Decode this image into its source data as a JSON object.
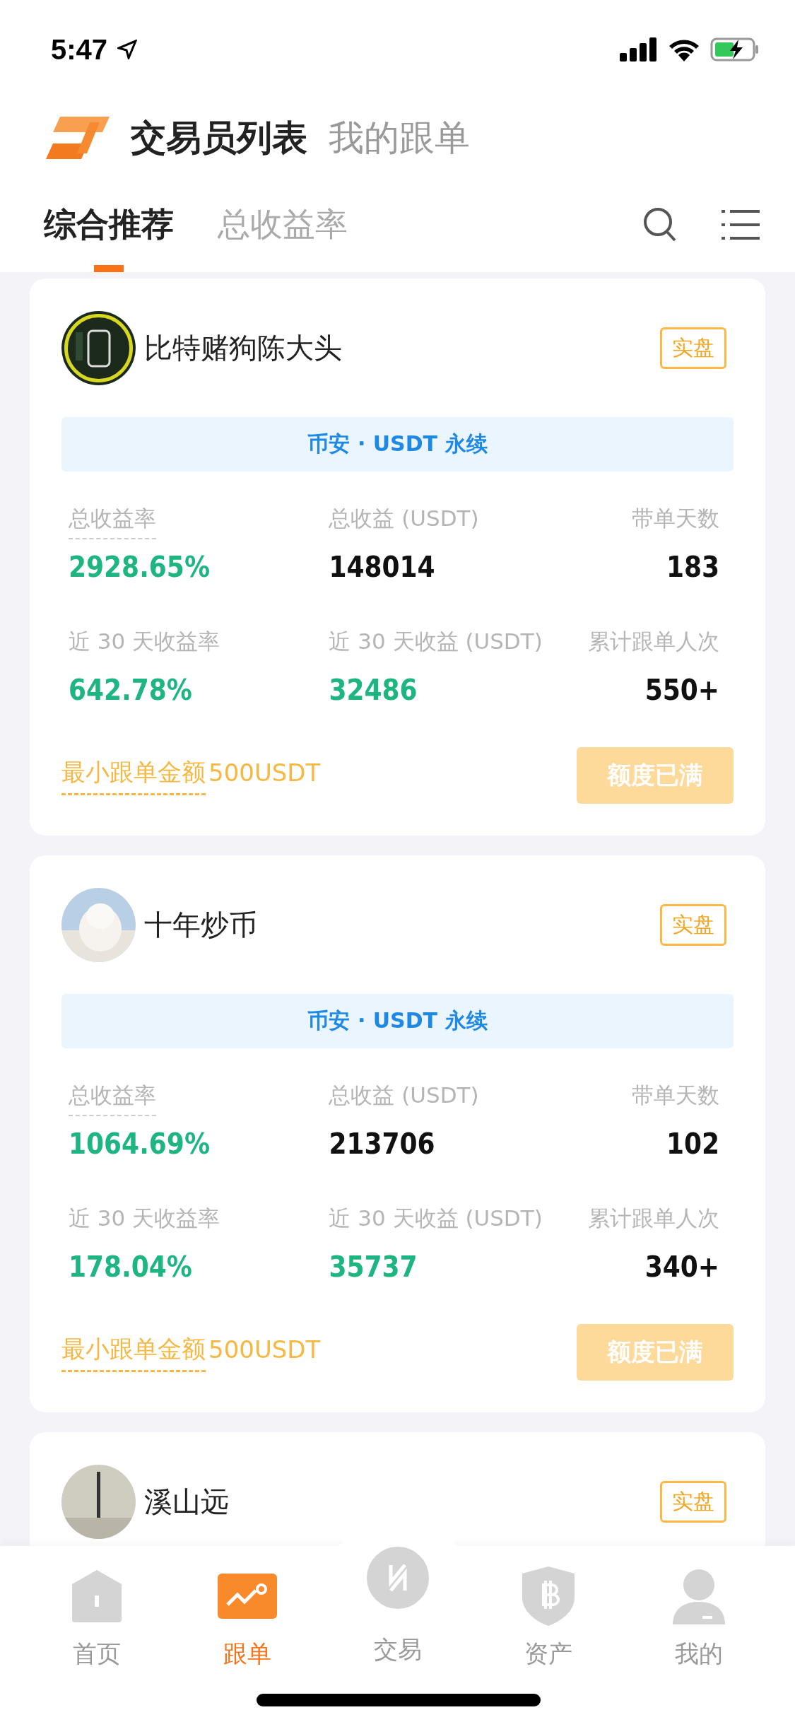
{
  "status_bar": {
    "time": "5:47"
  },
  "header": {
    "title": "交易员列表",
    "secondary": "我的跟单"
  },
  "tabs": [
    {
      "label": "综合推荐",
      "selected": true
    },
    {
      "label": "总收益率",
      "selected": false
    }
  ],
  "traders": [
    {
      "name": "比特赌狗陈大头",
      "badge": "实盘",
      "market": "币安 · USDT 永续",
      "stats": [
        {
          "label": "总收益率",
          "value": "2928.65%",
          "color": "#1db580",
          "underlined": true
        },
        {
          "label": "总收益 (USDT)",
          "value": "148014",
          "color": "#111111",
          "underlined": false
        },
        {
          "label": "带单天数",
          "value": "183",
          "color": "#111111",
          "underlined": false
        },
        {
          "label": "近 30 天收益率",
          "value": "642.78%",
          "color": "#1db580",
          "underlined": false
        },
        {
          "label": "近 30 天收益 (USDT)",
          "value": "32486",
          "color": "#1db580",
          "underlined": false
        },
        {
          "label": "累计跟单人次",
          "value": "550+",
          "color": "#111111",
          "underlined": false
        }
      ],
      "min_label": "最小跟单金额",
      "min_amount": "500USDT",
      "button": {
        "label": "额度已满",
        "disabled": true
      }
    },
    {
      "name": "十年炒币",
      "badge": "实盘",
      "market": "币安 · USDT 永续",
      "stats": [
        {
          "label": "总收益率",
          "value": "1064.69%",
          "color": "#1db580",
          "underlined": true
        },
        {
          "label": "总收益 (USDT)",
          "value": "213706",
          "color": "#111111",
          "underlined": false
        },
        {
          "label": "带单天数",
          "value": "102",
          "color": "#111111",
          "underlined": false
        },
        {
          "label": "近 30 天收益率",
          "value": "178.04%",
          "color": "#1db580",
          "underlined": false
        },
        {
          "label": "近 30 天收益 (USDT)",
          "value": "35737",
          "color": "#1db580",
          "underlined": false
        },
        {
          "label": "累计跟单人次",
          "value": "340+",
          "color": "#111111",
          "underlined": false
        }
      ],
      "min_label": "最小跟单金额",
      "min_amount": "500USDT",
      "button": {
        "label": "额度已满",
        "disabled": true
      }
    },
    {
      "name": "溪山远",
      "badge": "实盘"
    }
  ],
  "nav": [
    {
      "label": "首页",
      "selected": false
    },
    {
      "label": "跟单",
      "selected": true
    },
    {
      "label": "交易",
      "selected": false
    },
    {
      "label": "资产",
      "selected": false
    },
    {
      "label": "我的",
      "selected": false
    }
  ]
}
